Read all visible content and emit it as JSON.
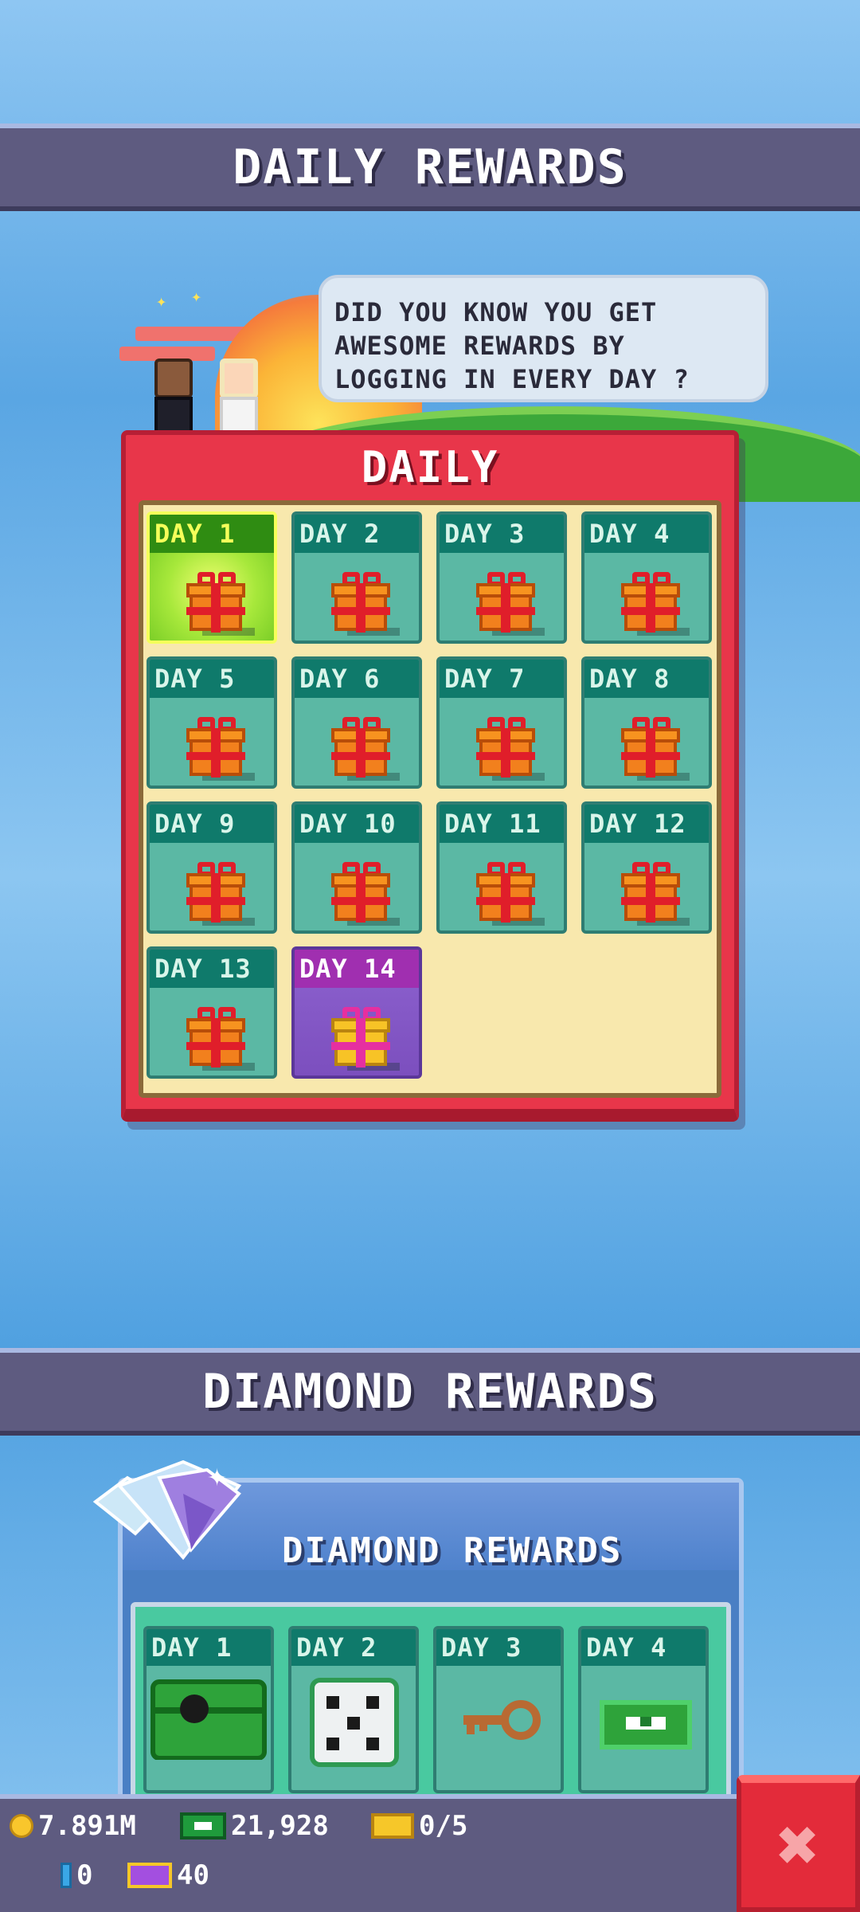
{
  "headers": {
    "daily_rewards": "DAILY REWARDS",
    "diamond_rewards": "DIAMOND REWARDS"
  },
  "tip": {
    "line1": "DID YOU KNOW YOU GET",
    "line2": "AWESOME REWARDS BY",
    "line3": "LOGGING IN EVERY DAY ?"
  },
  "daily": {
    "title": "DAILY",
    "days": [
      {
        "label": "DAY 1",
        "reward_icon": "gift-icon",
        "state": "today"
      },
      {
        "label": "DAY 2",
        "reward_icon": "gift-icon",
        "state": "locked"
      },
      {
        "label": "DAY 3",
        "reward_icon": "gift-icon",
        "state": "locked"
      },
      {
        "label": "DAY 4",
        "reward_icon": "gift-icon",
        "state": "locked"
      },
      {
        "label": "DAY 5",
        "reward_icon": "gift-icon",
        "state": "locked"
      },
      {
        "label": "DAY 6",
        "reward_icon": "gift-icon",
        "state": "locked"
      },
      {
        "label": "DAY 7",
        "reward_icon": "gift-icon",
        "state": "locked"
      },
      {
        "label": "DAY 8",
        "reward_icon": "gift-icon",
        "state": "locked"
      },
      {
        "label": "DAY 9",
        "reward_icon": "gift-icon",
        "state": "locked"
      },
      {
        "label": "DAY 10",
        "reward_icon": "gift-icon",
        "state": "locked"
      },
      {
        "label": "DAY 11",
        "reward_icon": "gift-icon",
        "state": "locked"
      },
      {
        "label": "DAY 12",
        "reward_icon": "gift-icon",
        "state": "locked"
      },
      {
        "label": "DAY 13",
        "reward_icon": "gift-icon",
        "state": "locked"
      },
      {
        "label": "DAY 14",
        "reward_icon": "special-gift-icon",
        "state": "special"
      }
    ]
  },
  "diamond": {
    "title": "DIAMOND REWARDS",
    "days": [
      {
        "label": "DAY 1",
        "reward_icon": "chest-icon"
      },
      {
        "label": "DAY 2",
        "reward_icon": "dice-icon"
      },
      {
        "label": "DAY 3",
        "reward_icon": "key-icon"
      },
      {
        "label": "DAY 4",
        "reward_icon": "cash-icon"
      }
    ]
  },
  "currency": {
    "coins": "7.891M",
    "cash": "21,928",
    "tickets": "0/5",
    "energy": "0",
    "premium": "40"
  },
  "colors": {
    "daily_panel": "#e8364a",
    "cell_teal": "#5bb8a4",
    "today_green": "#a7e83b",
    "special_purple": "#8d62cf",
    "header_bar": "#5e5b80",
    "close_red": "#e32b3a"
  }
}
